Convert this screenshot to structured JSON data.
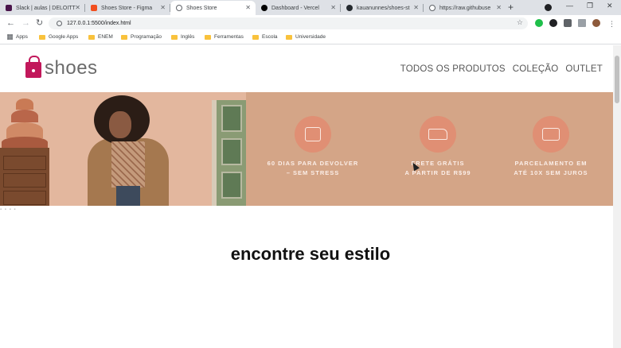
{
  "browser": {
    "tabs": [
      {
        "label": "Slack | aulas | DELOITT",
        "color": "#4a154b",
        "active": false
      },
      {
        "label": "Shoes Store - Figma",
        "color": "#f24e1e",
        "active": false
      },
      {
        "label": "Shoes Store",
        "color": "#5f6368",
        "active": true
      },
      {
        "label": "Dashboard - Vercel",
        "color": "#000000",
        "active": false
      },
      {
        "label": "kauanunnes/shoes-st",
        "color": "#24292e",
        "active": false
      },
      {
        "label": "https://raw.githubuse",
        "color": "#5f6368",
        "active": false
      }
    ],
    "new_tab": "+",
    "url": "127.0.0.1:5500/index.html",
    "bookmarks": [
      "Apps",
      "Google Apps",
      "ENEM",
      "Programação",
      "Inglês",
      "Ferramentas",
      "Escola",
      "Universidade"
    ]
  },
  "site": {
    "logo_text": "shoes",
    "nav": [
      "TODOS OS PRODUTOS",
      "COLEÇÃO",
      "OUTLET"
    ],
    "perks": [
      {
        "line1": "60 DIAS PARA DEVOLVER",
        "line2": "– SEM STRESS",
        "icon": "box-return-icon"
      },
      {
        "line1": "FRETE GRÁTIS",
        "line2": "A PARTIR DE R$99",
        "icon": "delivery-truck-icon"
      },
      {
        "line1": "PARCELAMENTO EM",
        "line2": "ATÉ 10X SEM JUROS",
        "icon": "wallet-icon"
      }
    ],
    "section_title": "encontre seu estilo"
  },
  "colors": {
    "brand": "#c2185b",
    "banner": "#d4a587",
    "perk_circle": "#e08f74"
  }
}
